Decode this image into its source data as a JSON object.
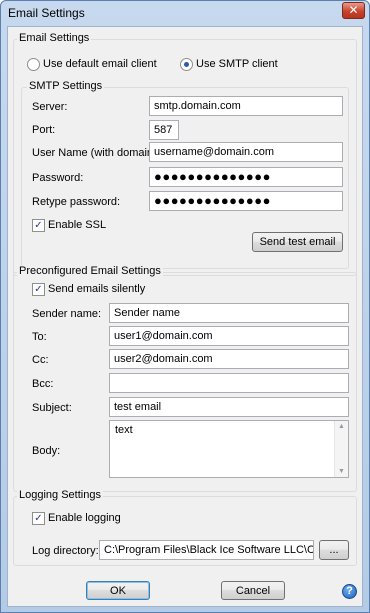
{
  "window": {
    "title": "Email Settings",
    "close_glyph": "✕"
  },
  "email_settings": {
    "legend": "Email Settings",
    "radio_default": "Use default email client",
    "radio_smtp": "Use SMTP client",
    "selected": "smtp"
  },
  "smtp": {
    "legend": "SMTP Settings",
    "server_label": "Server:",
    "server_value": "smtp.domain.com",
    "port_label": "Port:",
    "port_value": "587",
    "username_label": "User Name (with domain):",
    "username_value": "username@domain.com",
    "password_label": "Password:",
    "password_value": "●●●●●●●●●●●●●●",
    "retype_label": "Retype password:",
    "retype_value": "●●●●●●●●●●●●●●",
    "ssl_label": "Enable SSL",
    "ssl_checked": true,
    "test_button": "Send test email"
  },
  "preconfigured": {
    "legend": "Preconfigured Email Settings",
    "silent_label": "Send emails silently",
    "silent_checked": true,
    "sender_label": "Sender name:",
    "sender_value": "Sender name",
    "to_label": "To:",
    "to_value": "user1@domain.com",
    "cc_label": "Cc:",
    "cc_value": "user2@domain.com",
    "bcc_label": "Bcc:",
    "bcc_value": "",
    "subject_label": "Subject:",
    "subject_value": "test email",
    "body_label": "Body:",
    "body_value": "text"
  },
  "logging": {
    "legend": "Logging Settings",
    "enable_label": "Enable logging",
    "enable_checked": true,
    "dir_label": "Log directory:",
    "dir_value": "C:\\Program Files\\Black Ice Software LLC\\ColorPl",
    "browse_button": "..."
  },
  "footer": {
    "ok_button": "OK",
    "cancel_button": "Cancel",
    "help_glyph": "?"
  },
  "icons": {
    "check_glyph": "✓",
    "scroll_up": "▲",
    "scroll_down": "▼"
  },
  "colors": {
    "title_bar": "#c7d9ee",
    "close_button": "#c8432c",
    "dialog_bg": "#f0f0f0"
  }
}
